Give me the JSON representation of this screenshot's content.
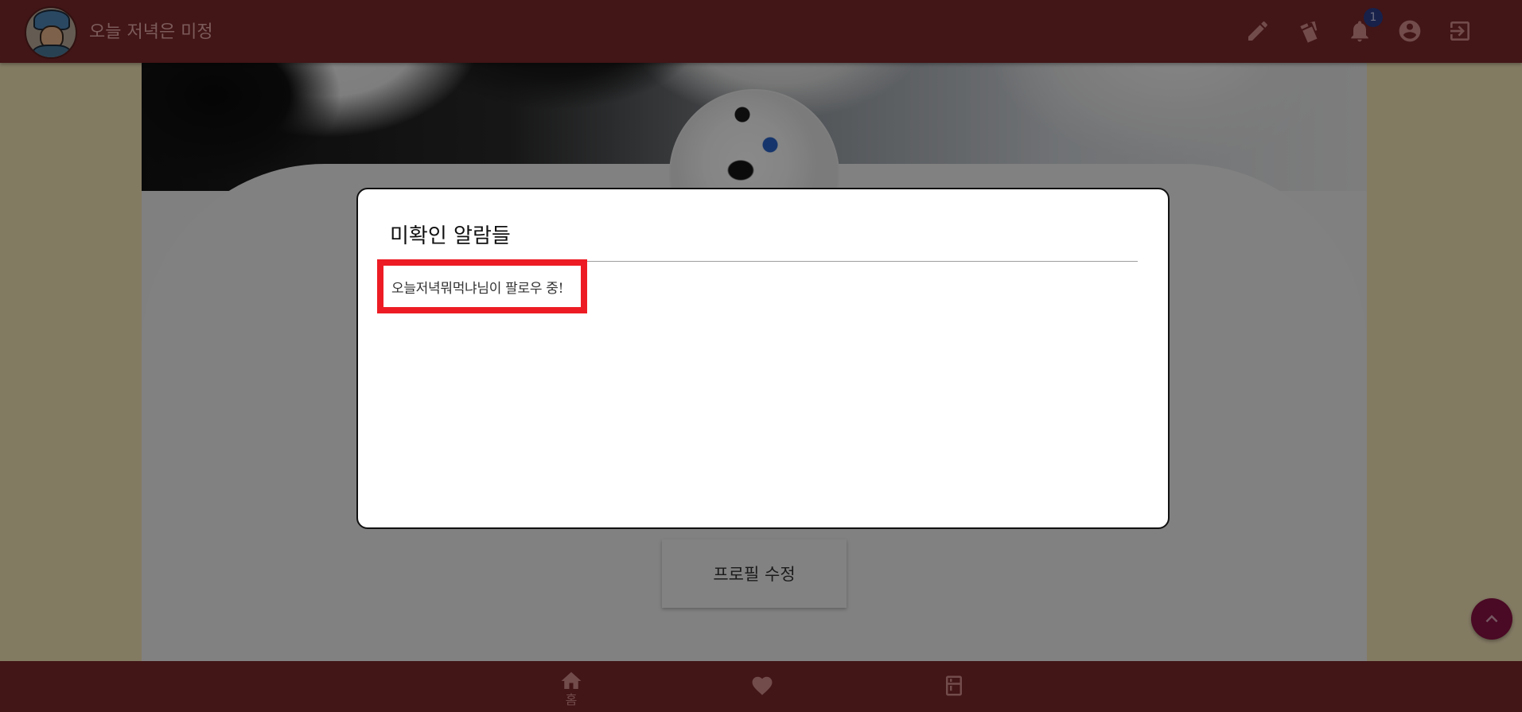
{
  "header": {
    "app_title": "오늘 저녁은 미정",
    "notification_count": "1",
    "icons": [
      "pencil-icon",
      "cards-icon",
      "bell-icon",
      "account-circle-icon",
      "logout-icon"
    ]
  },
  "profile": {
    "edit_button_label": "프로필 수정"
  },
  "modal": {
    "title": "미확인 알람들",
    "notifications": [
      {
        "text": "오늘저녁뭐먹냐님이 팔로우 중!"
      }
    ]
  },
  "bottom_nav": {
    "items": [
      {
        "label": "홈",
        "icon": "home-icon"
      },
      {
        "label": "",
        "icon": "heart-icon"
      },
      {
        "label": "",
        "icon": "fridge-icon"
      }
    ]
  },
  "colors": {
    "header_bg": "#7a2829",
    "badge_bg": "#2b3d8a",
    "highlight_border": "#ed1c24",
    "side_bg": "#f2e2b6",
    "scroll_button_bg": "#8a1244"
  }
}
